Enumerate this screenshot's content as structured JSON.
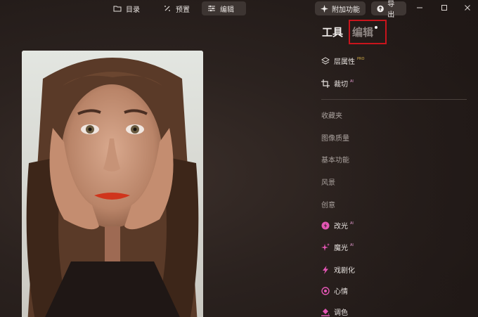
{
  "tabs": [
    {
      "label": "目录",
      "icon": "folder-icon"
    },
    {
      "label": "预置",
      "icon": "magic-wand-icon"
    },
    {
      "label": "编辑",
      "icon": "sliders-icon",
      "active": true
    }
  ],
  "actions": {
    "addon_label": "附加功能",
    "export_label": "导出"
  },
  "panel": {
    "tabs": {
      "tools": "工具",
      "edit": "编辑"
    },
    "top_items": [
      {
        "label": "层属性",
        "badge": "PRO",
        "icon": "layers-icon"
      },
      {
        "label": "裁切",
        "badge": "AI",
        "icon": "crop-icon"
      }
    ],
    "categories": [
      "收藏夹",
      "图像质量",
      "基本功能",
      "风景",
      "创意"
    ],
    "ai_items": [
      {
        "label": "改光",
        "badge": "AI",
        "icon": "relight-icon"
      },
      {
        "label": "魔光",
        "badge": "AI",
        "icon": "sparkle-icon"
      },
      {
        "label": "戏剧化",
        "badge": "",
        "icon": "lightning-icon"
      },
      {
        "label": "心情",
        "badge": "",
        "icon": "mood-icon"
      },
      {
        "label": "调色",
        "badge": "",
        "icon": "paint-bucket-icon"
      }
    ]
  },
  "colors": {
    "accent_pink": "#e356b4",
    "highlight_red": "#c8141c"
  }
}
